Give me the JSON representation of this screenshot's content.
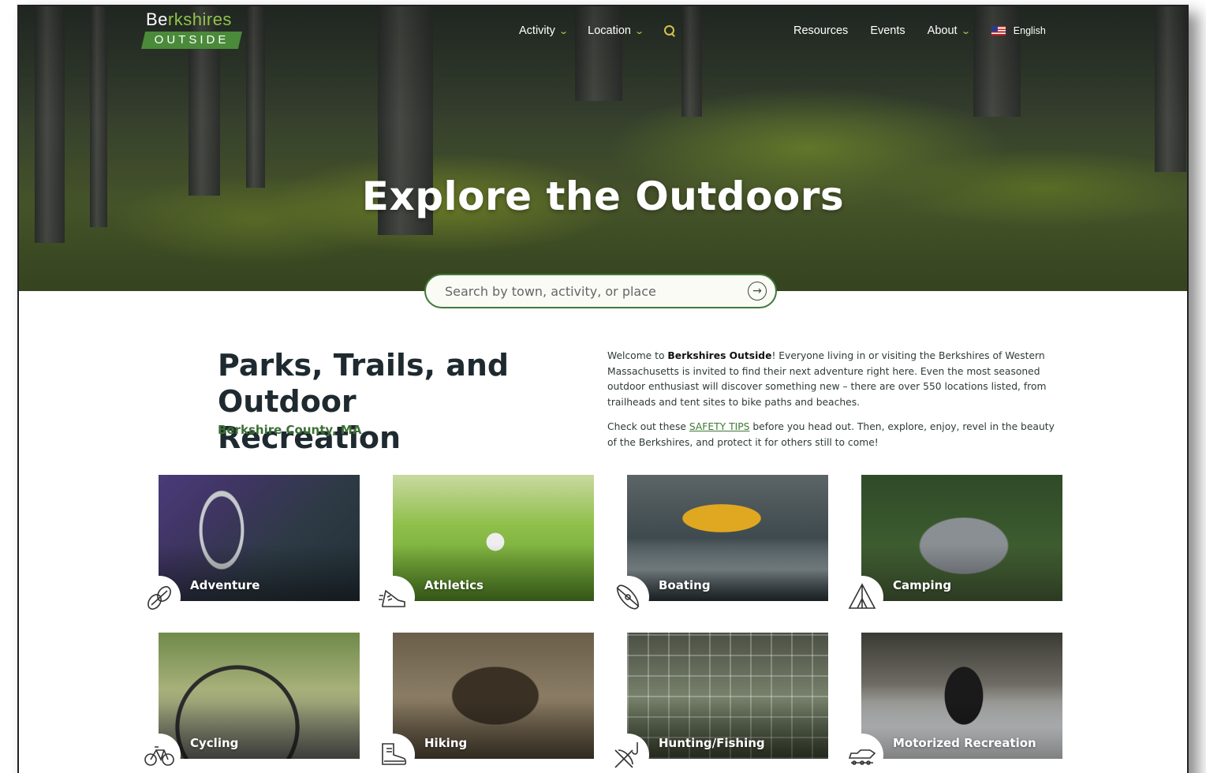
{
  "site": {
    "logo_top_a": "Be",
    "logo_top_b": "rkshires",
    "logo_bottom": "OUTSIDE"
  },
  "nav": {
    "activity": "Activity",
    "location": "Location",
    "resources": "Resources",
    "events": "Events",
    "about": "About",
    "language": "English"
  },
  "hero": {
    "title": "Explore the Outdoors",
    "search_placeholder": "Search by town, activity, or place"
  },
  "intro": {
    "title": "Parks, Trails, and Outdoor Recreation",
    "subtitle": "Berkshire County, MA",
    "p1_a": "Welcome to ",
    "p1_bold": "Berkshires Outside",
    "p1_b": "! Everyone living in or visiting the Berkshires of Western Massachusetts is invited to find their next adventure right here. Even the most seasoned outdoor enthusiast will discover something new – there are over 550 locations listed, from trailheads and tent sites to bike paths and beaches.",
    "p2_a": "Check out these ",
    "p2_link": "SAFETY TIPS",
    "p2_b": " before you head out. Then, explore, enjoy, revel in the beauty of the Berkshires, and protect it for others still to come!"
  },
  "categories": [
    {
      "label": "Adventure",
      "icon": "carabiner-rope-icon"
    },
    {
      "label": "Athletics",
      "icon": "sneaker-icon"
    },
    {
      "label": "Boating",
      "icon": "kayak-icon"
    },
    {
      "label": "Camping",
      "icon": "tent-icon"
    },
    {
      "label": "Cycling",
      "icon": "bicycle-icon"
    },
    {
      "label": "Hiking",
      "icon": "hiking-boot-icon"
    },
    {
      "label": "Hunting/Fishing",
      "icon": "bow-fishhook-icon"
    },
    {
      "label": "Motorized Recreation",
      "icon": "snowmobile-icon"
    }
  ],
  "colors": {
    "brand_green": "#3c7a34",
    "logo_green": "#4a8a3a",
    "nav_accent": "#d7c14a",
    "heading": "#1e2a2f"
  }
}
